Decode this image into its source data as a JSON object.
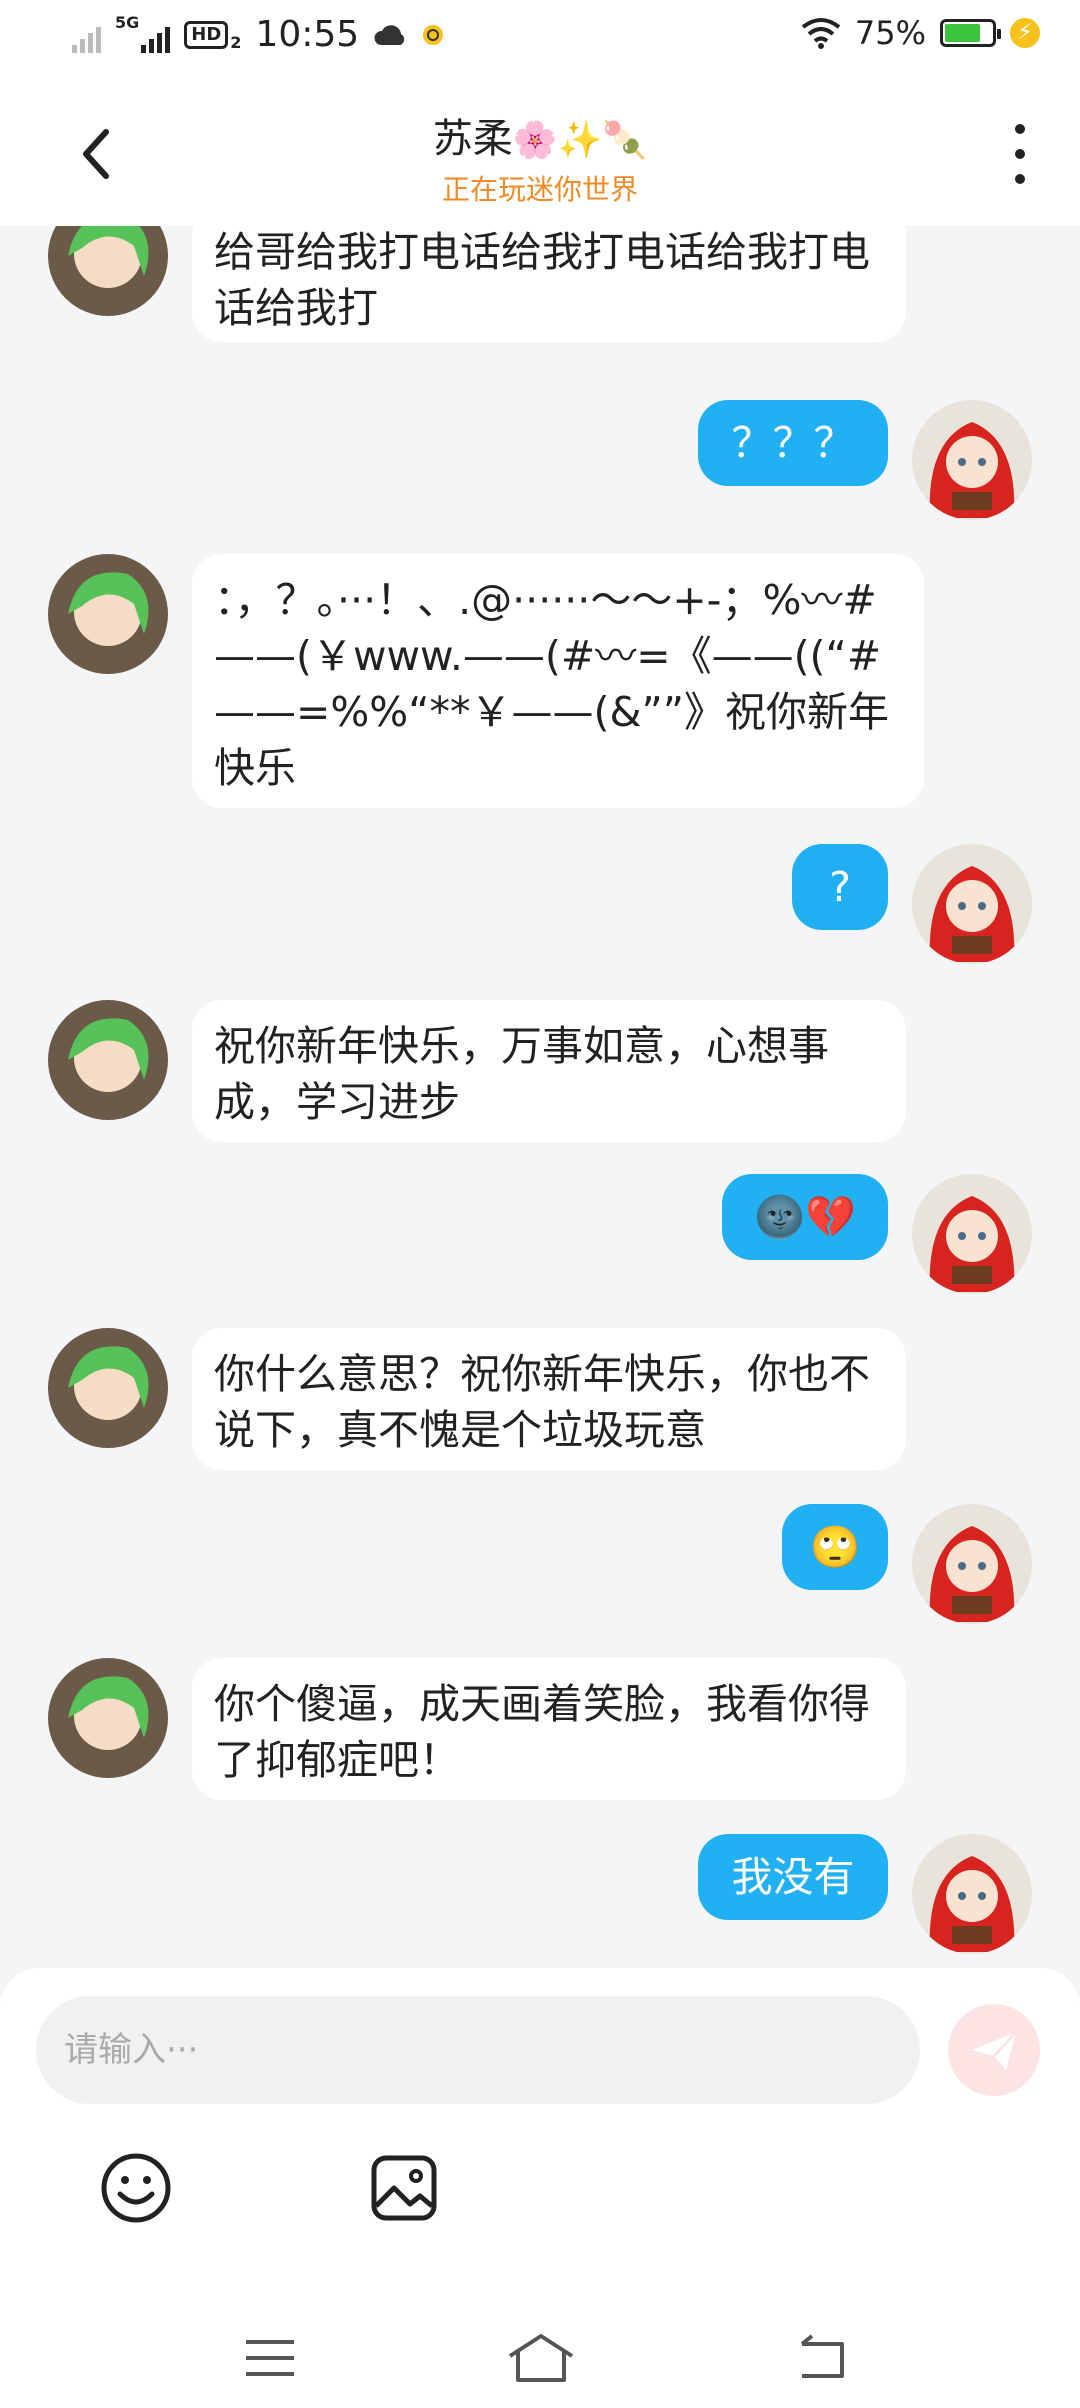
{
  "status_bar": {
    "network": "5G",
    "hd": "HD",
    "hd_sub": "2",
    "time": "10:55",
    "battery": "75%",
    "battery_level": 0.75
  },
  "header": {
    "title": "苏柔",
    "title_emojis": "🌸✨🍡",
    "subtitle": "正在玩迷你世界"
  },
  "messages": [
    {
      "side": "in",
      "text": "给哥给我打电话给我打电话给我打电话给我打"
    },
    {
      "side": "out",
      "text": "？？？"
    },
    {
      "side": "in",
      "text": "：，？。···！、.@······～～+-；%〰#——(￥www.——(#〰=《——((“#——=%%“**￥——(&””》祝你新年快乐"
    },
    {
      "side": "out",
      "text": "?"
    },
    {
      "side": "in",
      "text": "祝你新年快乐，万事如意，心想事成，学习进步"
    },
    {
      "side": "out",
      "text": "🌚💔"
    },
    {
      "side": "in",
      "text": "你什么意思？祝你新年快乐，你也不说下，真不愧是个垃圾玩意"
    },
    {
      "side": "out",
      "text": "🙄"
    },
    {
      "side": "in",
      "text": "你个傻逼，成天画着笑脸，我看你得了抑郁症吧！"
    },
    {
      "side": "out",
      "text": "我没有"
    }
  ],
  "input": {
    "placeholder": "请输入···"
  },
  "colors": {
    "accent": "#21b0f2",
    "subtitle": "#f28a25",
    "send_disabled": "#fde4e4"
  },
  "icons": [
    "back-icon",
    "more-icon",
    "send-icon",
    "emoji-icon",
    "image-icon",
    "menu-icon",
    "home-icon",
    "return-icon"
  ]
}
